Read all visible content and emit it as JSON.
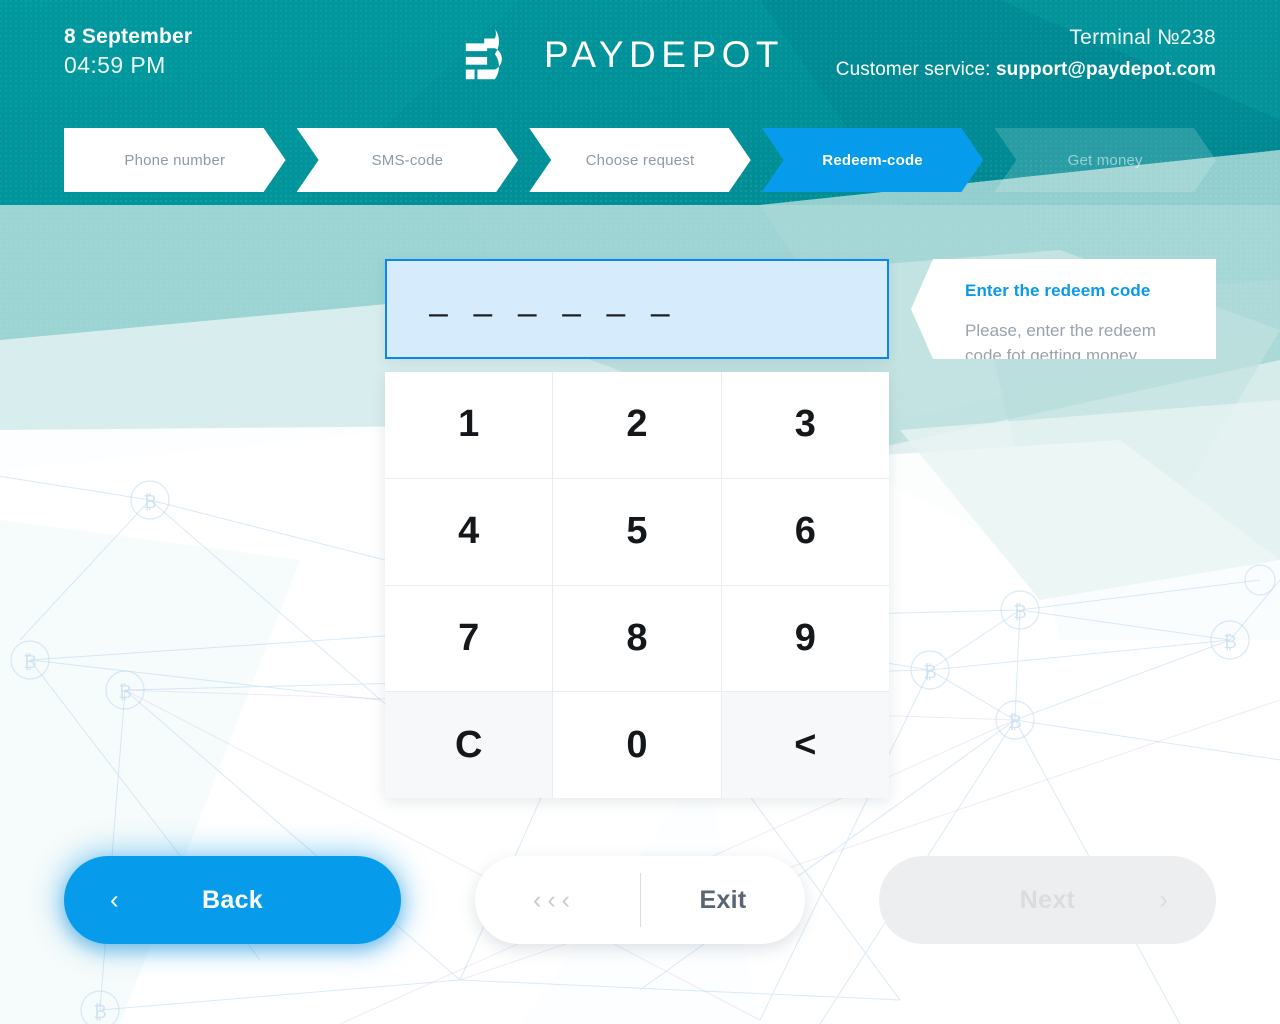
{
  "header": {
    "date": "8 September",
    "time": "04:59 PM",
    "logo_text": "PAYDEPOT",
    "logo_icon": "paydepot-b-logo",
    "terminal": "Terminal №238",
    "support_prefix": "Customer service:",
    "support_email": "support@paydepot.com",
    "teal": "#009097"
  },
  "steps": [
    {
      "label": "Phone number",
      "state": "done"
    },
    {
      "label": "SMS-code",
      "state": "done"
    },
    {
      "label": "Choose request",
      "state": "done"
    },
    {
      "label": "Redeem-code",
      "state": "active"
    },
    {
      "label": "Get money",
      "state": "upcoming"
    }
  ],
  "code_input": {
    "value": "",
    "mask": "– – – – – –",
    "length": 6,
    "fill": "#d6ecfc",
    "border": "#0a86f0"
  },
  "tooltip": {
    "title": "Enter the redeem code",
    "body": "Please, enter the redeem code fot getting money.",
    "title_color": "#0a9ae8"
  },
  "keypad": {
    "keys": [
      {
        "label": "1",
        "name": "key-1",
        "muted": false
      },
      {
        "label": "2",
        "name": "key-2",
        "muted": false
      },
      {
        "label": "3",
        "name": "key-3",
        "muted": false
      },
      {
        "label": "4",
        "name": "key-4",
        "muted": false
      },
      {
        "label": "5",
        "name": "key-5",
        "muted": false
      },
      {
        "label": "6",
        "name": "key-6",
        "muted": false
      },
      {
        "label": "7",
        "name": "key-7",
        "muted": false
      },
      {
        "label": "8",
        "name": "key-8",
        "muted": false
      },
      {
        "label": "9",
        "name": "key-9",
        "muted": false
      },
      {
        "label": "C",
        "name": "key-clear",
        "muted": true
      },
      {
        "label": "0",
        "name": "key-0",
        "muted": false
      },
      {
        "label": "<",
        "name": "key-backspace",
        "muted": true
      }
    ]
  },
  "footer": {
    "back_label": "Back",
    "back_chevron": "‹",
    "exit_label": "Exit",
    "exit_chevrons": "‹‹‹",
    "next_label": "Next",
    "next_chevron": "›",
    "next_disabled": true,
    "accent": "#079ceb"
  }
}
